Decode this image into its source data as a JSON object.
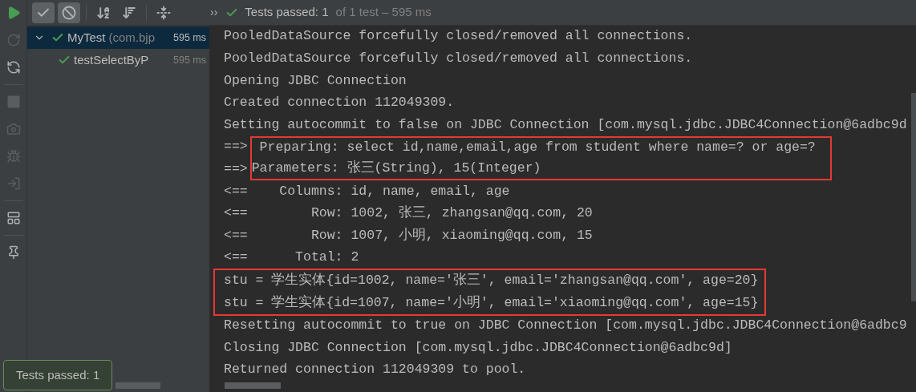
{
  "side_tools": [
    {
      "kind": "run",
      "disabled": false
    },
    {
      "kind": "rerun",
      "disabled": true
    },
    {
      "kind": "toggle",
      "disabled": false
    },
    {
      "kind": "stop",
      "disabled": true
    },
    {
      "kind": "snapshot",
      "disabled": true
    },
    {
      "kind": "debug",
      "disabled": true
    },
    {
      "kind": "import",
      "disabled": true
    },
    {
      "kind": "layout",
      "disabled": false
    },
    {
      "kind": "pin",
      "disabled": false
    }
  ],
  "top_tools": [
    {
      "kind": "passed",
      "selected": true
    },
    {
      "kind": "ignored",
      "selected": true
    },
    {
      "kind": "sort-alpha",
      "selected": false
    },
    {
      "kind": "sort-duration",
      "selected": false
    },
    {
      "kind": "collapse",
      "selected": false
    }
  ],
  "status": {
    "more": "››",
    "main": "Tests passed: 1",
    "detail": "of 1 test – 595 ms"
  },
  "tree": [
    {
      "name": "MyTest",
      "qualifier": "(com.bjp",
      "time": "595 ms",
      "selected": true,
      "expanded": true,
      "children": [
        {
          "name": "testSelectByP",
          "time": "595 ms",
          "selected": false
        }
      ]
    }
  ],
  "console": [
    {
      "kind": "plain",
      "lines": [
        {
          "text": "PooledDataSource forcefully closed/removed all connections."
        },
        {
          "text": "PooledDataSource forcefully closed/removed all connections."
        },
        {
          "text": "Opening JDBC Connection"
        },
        {
          "text": "Created connection 112049309."
        },
        {
          "text": "Setting autocommit to false on JDBC Connection [com.mysql.jdbc.JDBC4Connection@6adbc9d"
        }
      ]
    },
    {
      "kind": "highlighted",
      "lines": [
        {
          "prefix": "==>",
          "text": " Preparing: select id,name,email,age from student where name=? or age=? "
        },
        {
          "prefix": "==>",
          "text": "Parameters: 张三(String), 15(Integer)"
        }
      ]
    },
    {
      "kind": "plain",
      "lines": [
        {
          "text": "<==    Columns: id, name, email, age"
        },
        {
          "text": "<==        Row: 1002, 张三, zhangsan@qq.com, 20"
        },
        {
          "text": "<==        Row: 1007, 小明, xiaoming@qq.com, 15"
        },
        {
          "text": "<==      Total: 2"
        }
      ]
    },
    {
      "kind": "highlighted",
      "lines": [
        {
          "text": "stu = 学生实体{id=1002, name='张三', email='zhangsan@qq.com', age=20}"
        },
        {
          "text": "stu = 学生实体{id=1007, name='小明', email='xiaoming@qq.com', age=15}"
        }
      ]
    },
    {
      "kind": "plain",
      "lines": [
        {
          "text": "Resetting autocommit to true on JDBC Connection [com.mysql.jdbc.JDBC4Connection@6adbc9"
        },
        {
          "text": "Closing JDBC Connection [com.mysql.jdbc.JDBC4Connection@6adbc9d]"
        },
        {
          "text": "Returned connection 112049309 to pool."
        }
      ]
    }
  ],
  "balloon": {
    "text": "Tests passed: 1"
  }
}
